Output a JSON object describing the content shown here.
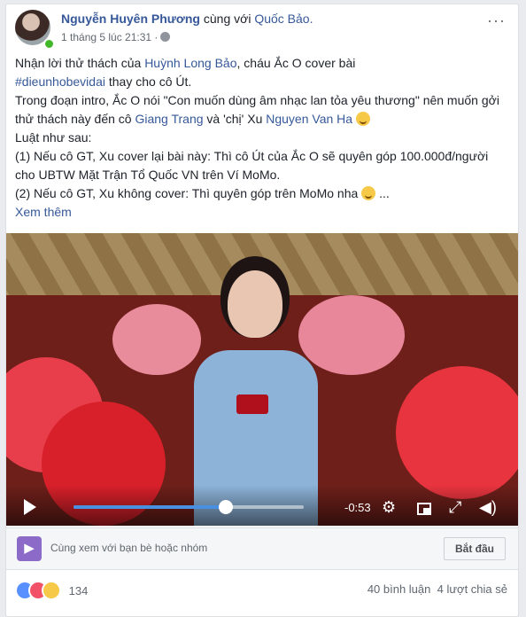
{
  "post": {
    "author": "Nguyễn Huyên Phương",
    "with_text": "cùng với",
    "tagged": "Quốc Bảo.",
    "time": "1 tháng 5 lúc 21:31 ·",
    "more": "···"
  },
  "body": {
    "l1a": "Nhận lời thử thách của ",
    "l1link": "Huỳnh Long Bảo",
    "l1b": ", cháu Ắc O cover bài",
    "hashtag": "#dieunhobevidai",
    "l2b": " thay cho cô Út.",
    "l3a": "Trong đoạn intro, Ắc O nói \"Con muốn dùng âm nhạc lan tỏa yêu thương\" nên muốn gởi thử thách này đến cô ",
    "l3link1": "Giang Trang",
    "l3mid": " và 'chị' Xu ",
    "l3link2": "Nguyen Van Ha",
    "l4": "Luật như sau:",
    "l5": "(1) Nếu cô GT, Xu cover lại bài này: Thì cô Út của Ắc O sẽ quyên góp 100.000đ/người cho UBTW Mặt Trận Tổ Quốc VN trên Ví MoMo.",
    "l6": "(2) Nếu cô GT, Xu không cover: Thì quyên góp trên MoMo nha",
    "l6end": " ...",
    "see_more": "Xem thêm"
  },
  "video": {
    "time_remaining": "-0:53",
    "progress": 0.66
  },
  "watch_party": {
    "text": "Cùng xem với bạn bè hoặc nhóm",
    "button": "Bắt đầu"
  },
  "reactions": {
    "count": "134",
    "comments": "40 bình luận",
    "shares": "4 lượt chia sẻ"
  }
}
